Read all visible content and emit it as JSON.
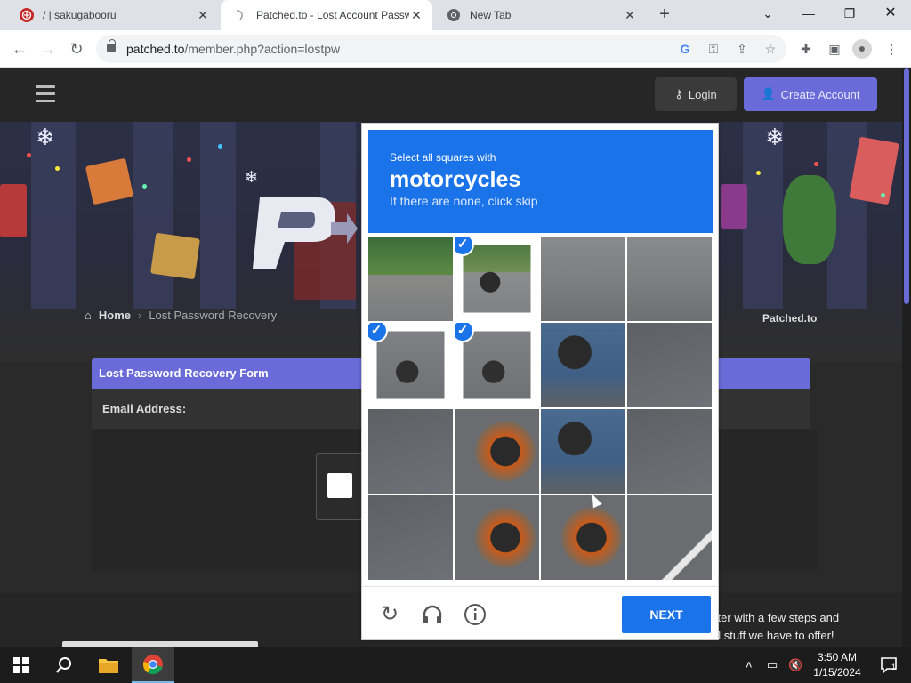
{
  "browser": {
    "tabs": [
      {
        "title": "/ | sakugabooru",
        "active": false
      },
      {
        "title": "Patched.to - Lost Account Passw",
        "active": true
      },
      {
        "title": "New Tab",
        "active": false
      }
    ],
    "url_host": "patched.to",
    "url_path": "/member.php?action=lostpw"
  },
  "site": {
    "login_label": "Login",
    "create_label": "Create Account",
    "breadcrumb_home": "Home",
    "breadcrumb_current": "Lost Password Recovery",
    "site_name": "Patched.to",
    "form_title": "Lost Password Recovery Form",
    "email_label": "Email Address:",
    "footer_line1": "ster with a few steps and",
    "footer_line2": "ol stuff we have to offer!"
  },
  "captcha": {
    "instruction": "Select all squares with",
    "target": "motorcycles",
    "hint": "If there are none, click skip",
    "next_label": "NEXT",
    "selected_cells": [
      1,
      4,
      5
    ]
  },
  "taskbar": {
    "time": "3:50 AM",
    "date": "1/15/2024",
    "notification_count": "1"
  },
  "colors": {
    "captcha_blue": "#1a73e8",
    "site_accent": "#6a6ad8"
  }
}
